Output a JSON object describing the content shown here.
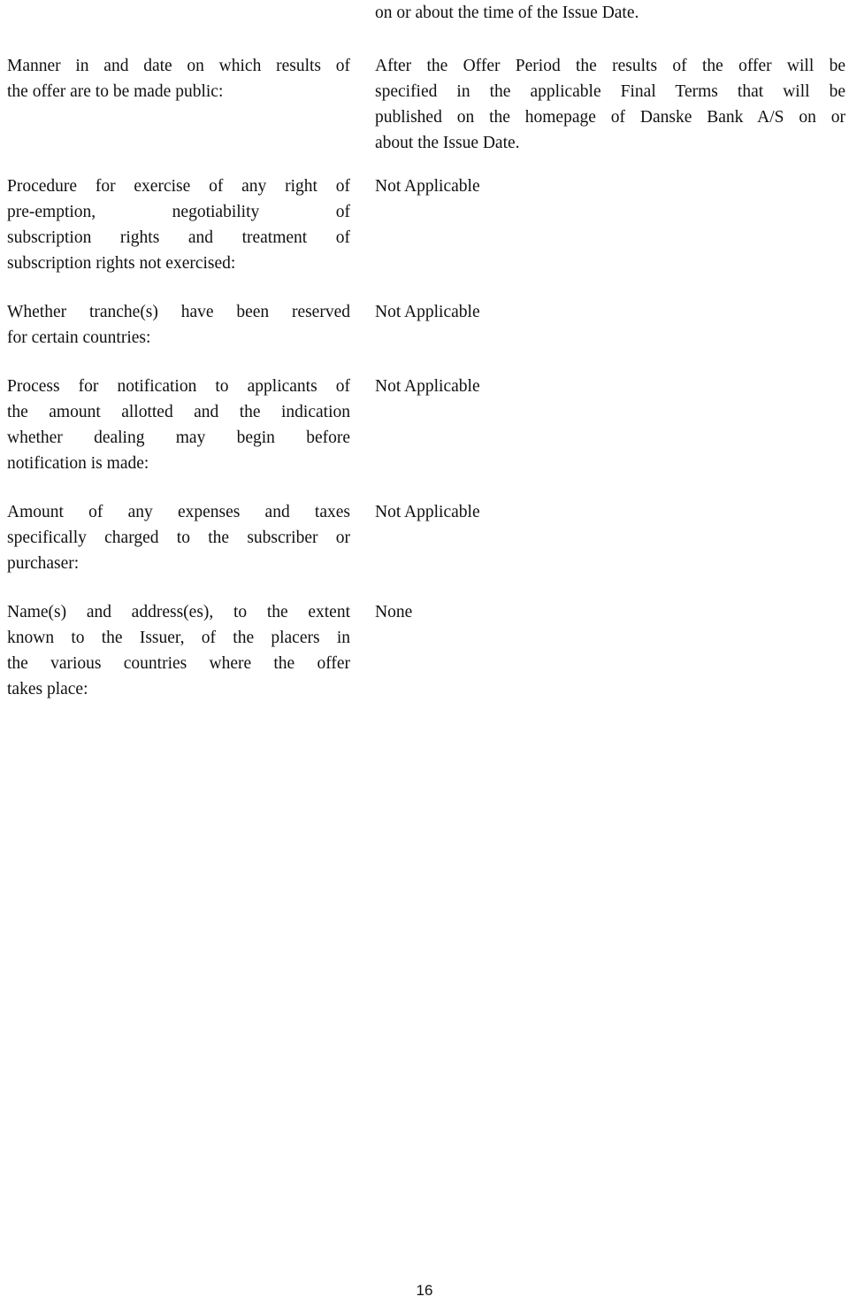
{
  "document": {
    "page_number": "16",
    "continuation_text": "on or about the time of the Issue Date.",
    "rows": [
      {
        "label_lines": [
          "Manner in and date on which results of",
          "the offer are to be made public:"
        ],
        "label_text": "Manner in and date on which results of the offer are to be made public:",
        "value_lines": [
          "After the Offer Period the results of the offer will be",
          "specified in the applicable Final Terms that will be",
          "published on the homepage of Danske Bank A/S on or",
          "about the Issue Date."
        ],
        "value_text": "After the Offer Period the results of the offer will be specified in the applicable Final Terms that will be published on the homepage of Danske Bank A/S on or about the Issue Date."
      },
      {
        "label_lines": [
          "Procedure for exercise of any right of",
          "pre-emption, negotiability of",
          "subscription rights and treatment of",
          "subscription rights not exercised:"
        ],
        "label_text": "Procedure for exercise of any right of pre-emption, negotiability of subscription rights and treatment of subscription rights not exercised:",
        "value_lines": [
          "Not Applicable"
        ],
        "value_text": "Not Applicable"
      },
      {
        "label_lines": [
          "Whether tranche(s) have been reserved",
          "for certain countries:"
        ],
        "label_text": "Whether tranche(s) have been reserved for certain countries:",
        "value_lines": [
          "Not Applicable"
        ],
        "value_text": "Not Applicable"
      },
      {
        "label_lines": [
          "Process for notification to applicants of",
          "the amount allotted and the indication",
          "whether dealing may begin before",
          "notification is made:"
        ],
        "label_text": "Process for notification to applicants of the amount allotted and the indication whether dealing may begin before notification is made:",
        "value_lines": [
          "Not Applicable"
        ],
        "value_text": "Not Applicable"
      },
      {
        "label_lines": [
          "Amount of any expenses and taxes",
          "specifically charged to the subscriber or",
          "purchaser:"
        ],
        "label_text": "Amount of any expenses and taxes specifically charged to the subscriber or purchaser:",
        "value_lines": [
          "Not Applicable"
        ],
        "value_text": "Not Applicable"
      },
      {
        "label_lines": [
          "Name(s) and address(es), to the extent",
          "known to the Issuer, of the placers in",
          "the various countries where the offer",
          "takes place:"
        ],
        "label_text": "Name(s) and address(es), to the extent known to the Issuer, of the placers in the various countries where the offer takes place:",
        "value_lines": [
          "None"
        ],
        "value_text": "None"
      }
    ]
  }
}
